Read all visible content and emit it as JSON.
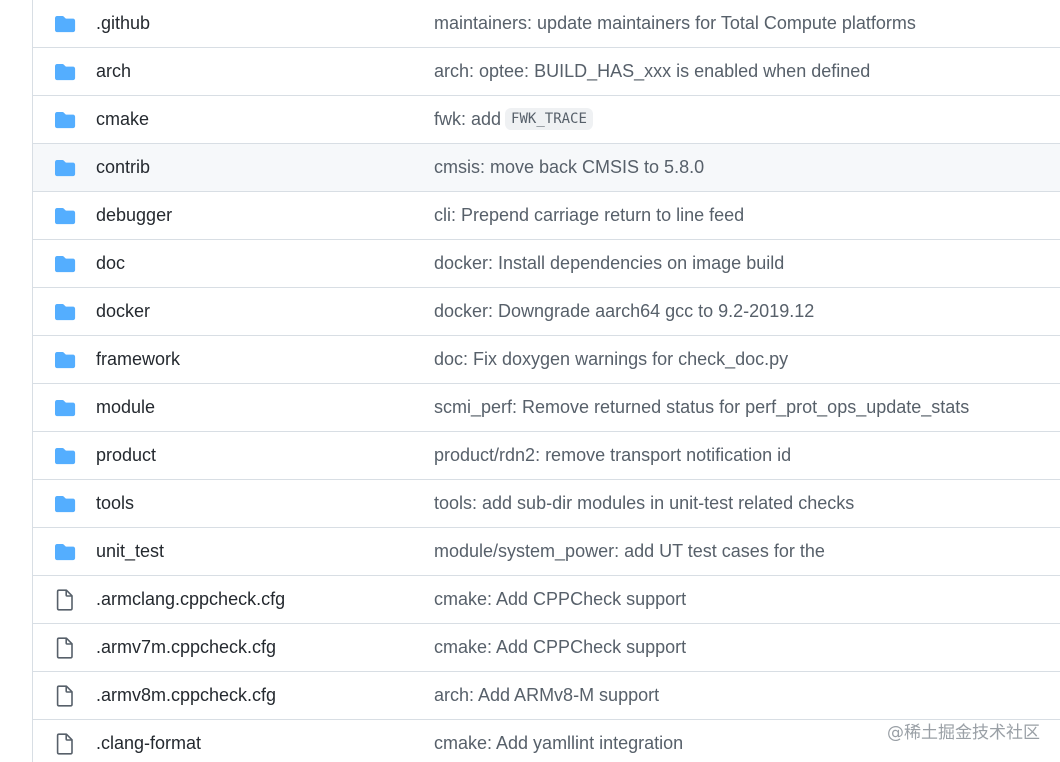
{
  "colors": {
    "folder_icon": "#54aeff",
    "file_icon": "#57606a",
    "name_text": "#24292f",
    "message_text": "#57606a",
    "row_border": "#d8dee4",
    "hover_bg": "#f6f8fa"
  },
  "rows": [
    {
      "type": "folder",
      "icon": "folder-icon",
      "name": ".github",
      "message": "maintainers: update maintainers for Total Compute platforms",
      "code": ""
    },
    {
      "type": "folder",
      "icon": "folder-icon",
      "name": "arch",
      "message": "arch: optee: BUILD_HAS_xxx is enabled when defined",
      "code": ""
    },
    {
      "type": "folder",
      "icon": "folder-icon",
      "name": "cmake",
      "message": "fwk: add",
      "code": "FWK_TRACE"
    },
    {
      "type": "folder",
      "icon": "folder-icon",
      "name": "contrib",
      "message": "cmsis: move back CMSIS to 5.8.0",
      "code": "",
      "hovered": true
    },
    {
      "type": "folder",
      "icon": "folder-icon",
      "name": "debugger",
      "message": "cli: Prepend carriage return to line feed",
      "code": ""
    },
    {
      "type": "folder",
      "icon": "folder-icon",
      "name": "doc",
      "message": "docker: Install dependencies on image build",
      "code": ""
    },
    {
      "type": "folder",
      "icon": "folder-icon",
      "name": "docker",
      "message": "docker: Downgrade aarch64 gcc to 9.2-2019.12",
      "code": ""
    },
    {
      "type": "folder",
      "icon": "folder-icon",
      "name": "framework",
      "message": "doc: Fix doxygen warnings for check_doc.py",
      "code": ""
    },
    {
      "type": "folder",
      "icon": "folder-icon",
      "name": "module",
      "message": "scmi_perf: Remove returned status for perf_prot_ops_update_stats",
      "code": ""
    },
    {
      "type": "folder",
      "icon": "folder-icon",
      "name": "product",
      "message": "product/rdn2: remove transport notification id",
      "code": ""
    },
    {
      "type": "folder",
      "icon": "folder-icon",
      "name": "tools",
      "message": "tools: add sub-dir modules in unit-test related checks",
      "code": ""
    },
    {
      "type": "folder",
      "icon": "folder-icon",
      "name": "unit_test",
      "message": "module/system_power: add UT test cases for the",
      "code": ""
    },
    {
      "type": "file",
      "icon": "file-icon",
      "name": ".armclang.cppcheck.cfg",
      "message": "cmake: Add CPPCheck support",
      "code": ""
    },
    {
      "type": "file",
      "icon": "file-icon",
      "name": ".armv7m.cppcheck.cfg",
      "message": "cmake: Add CPPCheck support",
      "code": ""
    },
    {
      "type": "file",
      "icon": "file-icon",
      "name": ".armv8m.cppcheck.cfg",
      "message": "arch: Add ARMv8-M support",
      "code": ""
    },
    {
      "type": "file",
      "icon": "file-icon",
      "name": ".clang-format",
      "message": "cmake: Add yamllint integration",
      "code": ""
    }
  ],
  "watermark": "@稀土掘金技术社区"
}
